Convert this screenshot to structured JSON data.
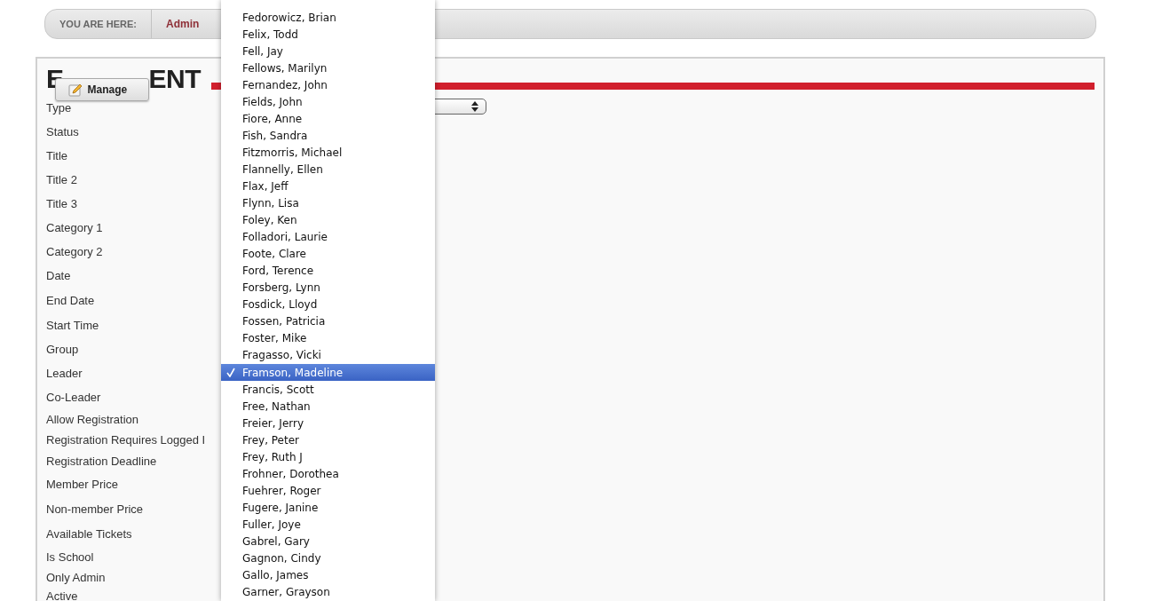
{
  "breadcrumb": {
    "label": "YOU ARE HERE:",
    "items": [
      "Admin"
    ]
  },
  "page": {
    "title_parts": [
      "E",
      "ENT"
    ],
    "manage_button": "Manage"
  },
  "fields": [
    {
      "label": "Type",
      "kind": "select"
    },
    {
      "label": "Status"
    },
    {
      "label": "Title"
    },
    {
      "label": "Title 2"
    },
    {
      "label": "Title 3"
    },
    {
      "label": "Category 1"
    },
    {
      "label": "Category 2"
    },
    {
      "label": "Date"
    },
    {
      "label": "End Date"
    },
    {
      "label": "Start Time"
    },
    {
      "label": "Group"
    },
    {
      "label": "Leader"
    },
    {
      "label": "Co-Leader"
    },
    {
      "label": "Allow Registration"
    },
    {
      "label": "Registration Requires Logged I"
    },
    {
      "label": "Registration Deadline"
    },
    {
      "label": "Member Price"
    },
    {
      "label": "Non-member Price"
    },
    {
      "label": "Available Tickets"
    },
    {
      "label": "Is School"
    },
    {
      "label": "Only Admin"
    },
    {
      "label": "Active"
    }
  ],
  "dropdown": {
    "options": [
      {
        "label": "Fedorowicz, Brian",
        "selected": false
      },
      {
        "label": "Felix, Todd",
        "selected": false
      },
      {
        "label": "Fell, Jay",
        "selected": false
      },
      {
        "label": "Fellows, Marilyn",
        "selected": false
      },
      {
        "label": "Fernandez, John",
        "selected": false
      },
      {
        "label": "Fields, John",
        "selected": false
      },
      {
        "label": "Fiore, Anne",
        "selected": false
      },
      {
        "label": "Fish, Sandra",
        "selected": false
      },
      {
        "label": "Fitzmorris, Michael",
        "selected": false
      },
      {
        "label": "Flannelly, Ellen",
        "selected": false
      },
      {
        "label": "Flax, Jeff",
        "selected": false
      },
      {
        "label": "Flynn, Lisa",
        "selected": false
      },
      {
        "label": "Foley, Ken",
        "selected": false
      },
      {
        "label": "Folladori, Laurie",
        "selected": false
      },
      {
        "label": "Foote, Clare",
        "selected": false
      },
      {
        "label": "Ford, Terence",
        "selected": false
      },
      {
        "label": "Forsberg, Lynn",
        "selected": false
      },
      {
        "label": "Fosdick, Lloyd",
        "selected": false
      },
      {
        "label": "Fossen, Patricia",
        "selected": false
      },
      {
        "label": "Foster, Mike",
        "selected": false
      },
      {
        "label": "Fragasso, Vicki",
        "selected": false
      },
      {
        "label": "Framson, Madeline",
        "selected": true
      },
      {
        "label": "Francis, Scott",
        "selected": false
      },
      {
        "label": "Free, Nathan",
        "selected": false
      },
      {
        "label": "Freier, Jerry",
        "selected": false
      },
      {
        "label": "Frey, Peter",
        "selected": false
      },
      {
        "label": "Frey, Ruth J",
        "selected": false
      },
      {
        "label": "Frohner, Dorothea",
        "selected": false
      },
      {
        "label": "Fuehrer, Roger",
        "selected": false
      },
      {
        "label": "Fugere, Janine",
        "selected": false
      },
      {
        "label": "Fuller, Joye",
        "selected": false
      },
      {
        "label": "Gabrel, Gary",
        "selected": false
      },
      {
        "label": "Gagnon, Cindy",
        "selected": false
      },
      {
        "label": "Gallo, James",
        "selected": false
      },
      {
        "label": "Garner, Grayson",
        "selected": false
      }
    ]
  }
}
